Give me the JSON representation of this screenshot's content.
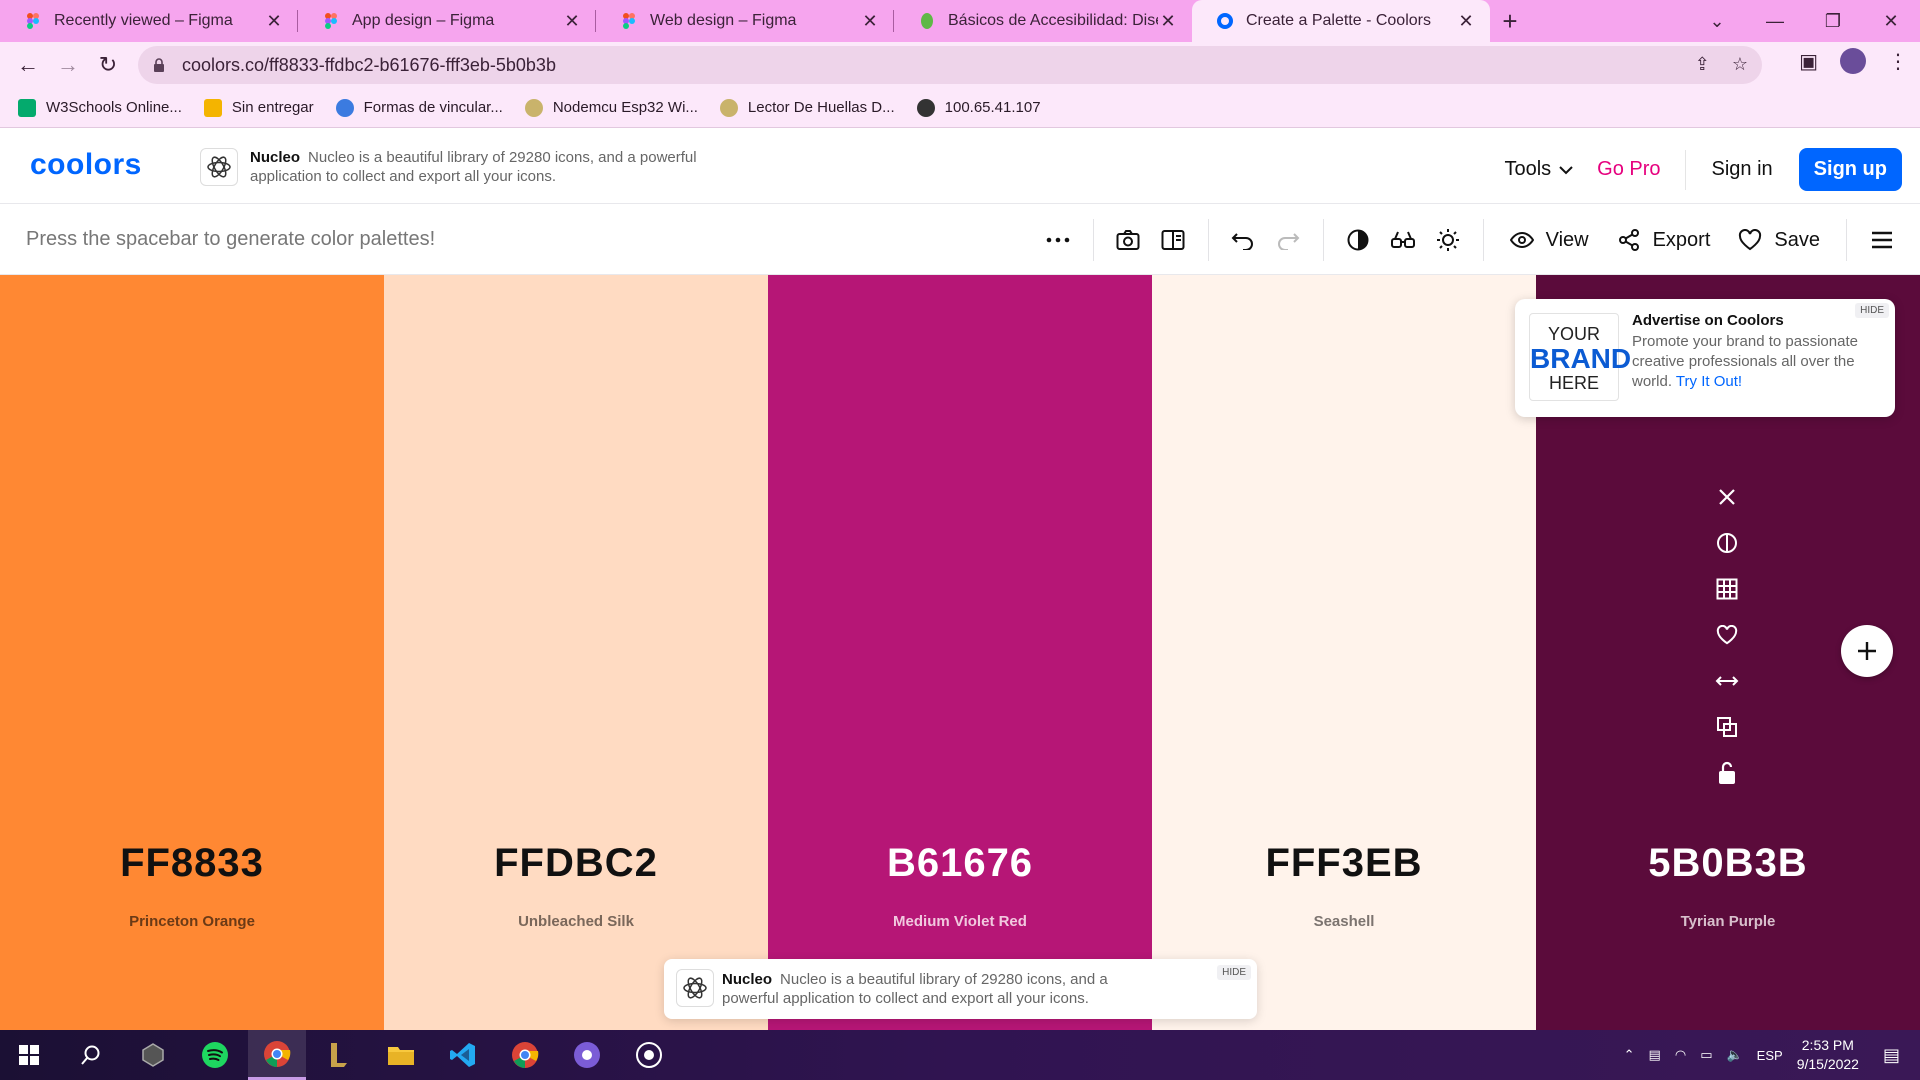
{
  "browser": {
    "tabs": [
      {
        "title": "Recently viewed – Figma",
        "icon": "figma-icon",
        "active": false
      },
      {
        "title": "App design – Figma",
        "icon": "figma-icon",
        "active": false
      },
      {
        "title": "Web design – Figma",
        "icon": "figma-icon",
        "active": false
      },
      {
        "title": "Básicos de Accesibilidad: Diseñar",
        "icon": "leaf-icon",
        "active": false
      },
      {
        "title": "Create a Palette - Coolors",
        "icon": "coolors-icon",
        "active": true
      }
    ],
    "url": "coolors.co/ff8833-ffdbc2-b61676-fff3eb-5b0b3b",
    "bookmarks": [
      {
        "label": "W3Schools Online...",
        "icon": "w3schools-icon"
      },
      {
        "label": "Sin entregar",
        "icon": "classroom-icon"
      },
      {
        "label": "Formas de vincular...",
        "icon": "link-icon"
      },
      {
        "label": "Nodemcu Esp32 Wi...",
        "icon": "board-icon"
      },
      {
        "label": "Lector De Huellas D...",
        "icon": "board-icon"
      },
      {
        "label": "100.65.41.107",
        "icon": "globe-icon"
      }
    ]
  },
  "header": {
    "logo": "coolors",
    "promo": {
      "name": "Nucleo",
      "text": "Nucleo is a beautiful library of 29280 icons, and a powerful application to collect and export all your icons."
    },
    "tools_label": "Tools",
    "gopro_label": "Go Pro",
    "signin_label": "Sign in",
    "signup_label": "Sign up"
  },
  "toolbar": {
    "hint": "Press the spacebar to generate color palettes!",
    "view_label": "View",
    "export_label": "Export",
    "save_label": "Save"
  },
  "palette": [
    {
      "hex": "FF8833",
      "name": "Princeton Orange",
      "bg": "#ff8833",
      "fg": "#111111",
      "sub": "#6b3a16"
    },
    {
      "hex": "FFDBC2",
      "name": "Unbleached Silk",
      "bg": "#ffdbc2",
      "fg": "#111111",
      "sub": "#7a675a"
    },
    {
      "hex": "B61676",
      "name": "Medium Violet Red",
      "bg": "#b61676",
      "fg": "#ffffff",
      "sub": "#f1c9df"
    },
    {
      "hex": "FFF3EB",
      "name": "Seashell",
      "bg": "#fff3eb",
      "fg": "#111111",
      "sub": "#7c7470"
    },
    {
      "hex": "5B0B3B",
      "name": "Tyrian Purple",
      "bg": "#5b0b3b",
      "fg": "#ffffff",
      "sub": "#d8c0cc"
    }
  ],
  "ad": {
    "logo_top": "YOUR",
    "logo_mid": "BRAND",
    "logo_bottom": "HERE",
    "title": "Advertise on Coolors",
    "desc": "Promote your brand to passionate creative professionals all over the world.",
    "link": "Try It Out!",
    "hide": "HIDE"
  },
  "bottom_promo": {
    "name": "Nucleo",
    "text": "Nucleo is a beautiful library of 29280 icons, and a powerful application to collect and export all your icons.",
    "hide": "HIDE"
  },
  "taskbar": {
    "lang": "ESP",
    "time": "2:53 PM",
    "date": "9/15/2022"
  }
}
